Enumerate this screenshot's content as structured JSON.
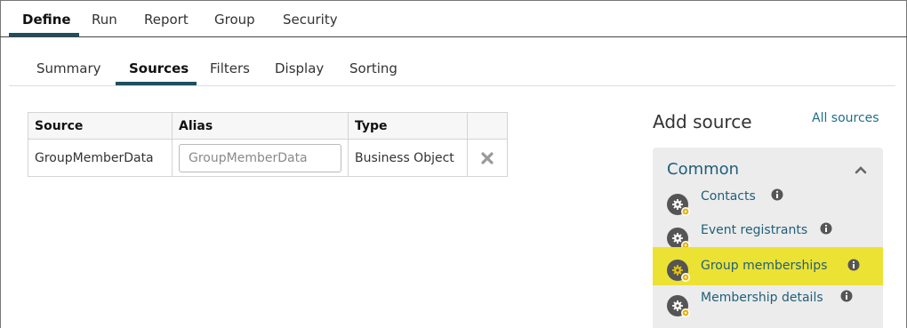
{
  "top_tabs": [
    {
      "label": "Define",
      "active": true
    },
    {
      "label": "Run",
      "active": false
    },
    {
      "label": "Report",
      "active": false
    },
    {
      "label": "Group",
      "active": false
    },
    {
      "label": "Security",
      "active": false
    }
  ],
  "sub_tabs": [
    {
      "label": "Summary",
      "active": false
    },
    {
      "label": "Sources",
      "active": true
    },
    {
      "label": "Filters",
      "active": false
    },
    {
      "label": "Display",
      "active": false
    },
    {
      "label": "Sorting",
      "active": false
    }
  ],
  "sources_table": {
    "headers": [
      "Source",
      "Alias",
      "Type",
      ""
    ],
    "rows": [
      {
        "source": "GroupMemberData",
        "alias_placeholder": "GroupMemberData",
        "alias_value": "",
        "type": "Business Object"
      }
    ]
  },
  "add_source": {
    "title": "Add source",
    "all_sources_link": "All sources",
    "section": "Common",
    "items": [
      {
        "label": "Contacts",
        "highlighted": false
      },
      {
        "label": "Event registrants",
        "highlighted": false
      },
      {
        "label": "Group memberships",
        "highlighted": true
      },
      {
        "label": "Membership details",
        "highlighted": false
      }
    ]
  },
  "colors": {
    "accent": "#1f4e5f",
    "link": "#1f6f8b",
    "highlight": "#ece234",
    "panel_bg": "#ececec"
  }
}
